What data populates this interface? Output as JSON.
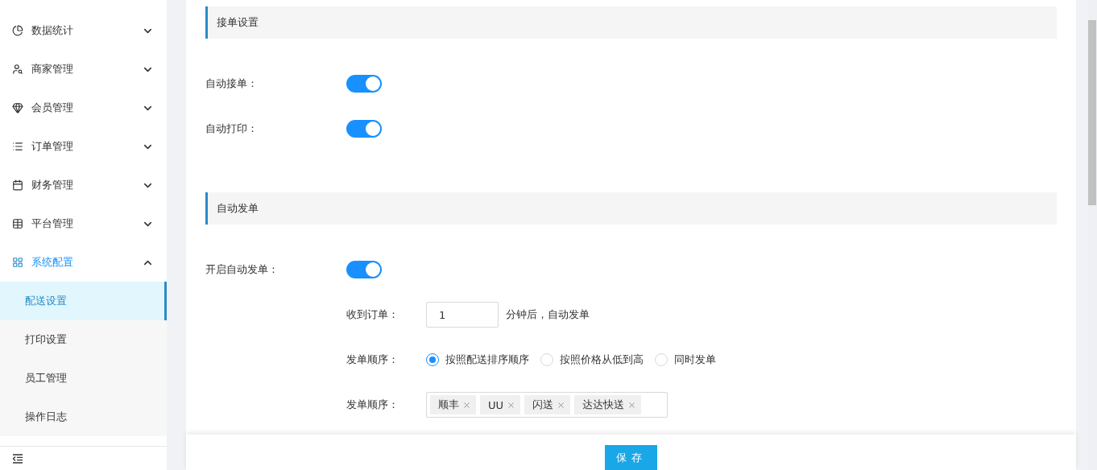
{
  "sidebar": {
    "items": [
      {
        "label": "数据统计",
        "expanded": false,
        "selected": false
      },
      {
        "label": "商家管理",
        "expanded": false,
        "selected": false
      },
      {
        "label": "会员管理",
        "expanded": false,
        "selected": false
      },
      {
        "label": "订单管理",
        "expanded": false,
        "selected": false
      },
      {
        "label": "财务管理",
        "expanded": false,
        "selected": false
      },
      {
        "label": "平台管理",
        "expanded": false,
        "selected": false
      },
      {
        "label": "系统配置",
        "expanded": true,
        "selected": true,
        "children": [
          {
            "label": "配送设置",
            "selected": true
          },
          {
            "label": "打印设置",
            "selected": false
          },
          {
            "label": "员工管理",
            "selected": false
          },
          {
            "label": "操作日志",
            "selected": false
          }
        ]
      }
    ]
  },
  "sections": [
    {
      "title": "接单设置",
      "fields": [
        {
          "kind": "switch",
          "label": "自动接单：",
          "on": true
        },
        {
          "kind": "switch",
          "label": "自动打印：",
          "on": true
        }
      ]
    },
    {
      "title": "自动发单",
      "fields": [
        {
          "kind": "switch",
          "label": "开启自动发单：",
          "on": true,
          "children": [
            {
              "kind": "number",
              "label": "收到订单：",
              "value": "1",
              "suffix": "分钟后，自动发单"
            },
            {
              "kind": "radio",
              "label": "发单顺序：",
              "options": [
                {
                  "label": "按照配送排序顺序",
                  "selected": true
                },
                {
                  "label": "按照价格从低到高",
                  "selected": false
                },
                {
                  "label": "同时发单",
                  "selected": false
                }
              ]
            },
            {
              "kind": "tags",
              "label": "发单顺序：",
              "tags": [
                "顺丰",
                "UU",
                "闪送",
                "达达快送"
              ]
            }
          ]
        }
      ]
    }
  ],
  "save_button": "保存"
}
